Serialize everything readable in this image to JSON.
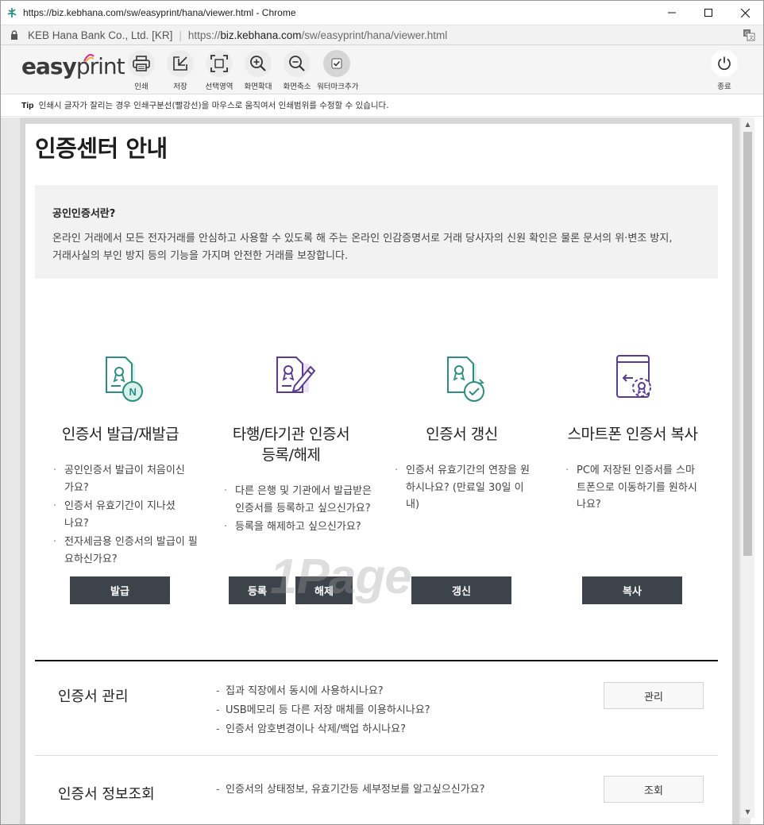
{
  "window": {
    "title": "https://biz.kebhana.com/sw/easyprint/hana/viewer.html - Chrome",
    "controls": {
      "minimize": "–",
      "maximize": "☐",
      "close": "✕"
    }
  },
  "address_bar": {
    "org": "KEB Hana Bank Co., Ltd. [KR]",
    "separator": "|",
    "url_scheme": "https://",
    "url_host": "biz.kebhana.com",
    "url_path": "/sw/easyprint/hana/viewer.html"
  },
  "toolbar": {
    "logo_easy": "easy",
    "logo_print": "print",
    "buttons": [
      {
        "label": "인쇄",
        "icon": "printer-icon"
      },
      {
        "label": "저장",
        "icon": "save-icon"
      },
      {
        "label": "선택영역",
        "icon": "select-area-icon"
      },
      {
        "label": "화면확대",
        "icon": "zoom-in-icon"
      },
      {
        "label": "화면축소",
        "icon": "zoom-out-icon"
      },
      {
        "label": "워터마크추가",
        "icon": "checkbox-icon"
      }
    ],
    "exit_label": "종료"
  },
  "tip": {
    "prefix": "Tip",
    "text": "인쇄시 글자가 잘리는 경우 인쇄구분선(빨강선)을 마우스로 움직여서 인쇄범위를 수정할 수 있습니다."
  },
  "page": {
    "title": "인증센터 안내",
    "info": {
      "heading": "공인인증서란?",
      "body_line1": "온라인 거래에서 모든 전자거래를 안심하고 사용할 수 있도록 해 주는 온라인 인감증명서로 거래 당사자의 신원 확인은 물론 문서의 위·변조 방지,",
      "body_line2": "거래사실의 부인 방지 등의 기능을 가지며 안전한 거래를 보장합니다."
    },
    "features": [
      {
        "title": "인증서 발급/재발급",
        "title2": "",
        "items": [
          "공인인증서 발급이 처음이신가요?",
          "인증서 유효기간이 지나셨나요?",
          "전자세금용 인증서의 발급이 필요하신가요?"
        ],
        "buttons": [
          "발급"
        ]
      },
      {
        "title": "타행/타기관 인증서",
        "title2": "등록/해제",
        "items": [
          "다른 은행 및 기관에서 발급받은 인증서를 등록하고 싶으신가요?",
          "등록을 해제하고 싶으신가요?"
        ],
        "buttons": [
          "등록",
          "해제"
        ]
      },
      {
        "title": "인증서 갱신",
        "title2": "",
        "items": [
          "인증서 유효기간의 연장을 원하시나요? (만료일 30일 이내)"
        ],
        "buttons": [
          "갱신"
        ]
      },
      {
        "title": "스마트폰 인증서 복사",
        "title2": "",
        "items": [
          "PC에 저장된 인증서를 스마트폰으로 이동하기를 원하시나요?"
        ],
        "buttons": [
          "복사"
        ]
      }
    ],
    "watermark": "1Page",
    "management": [
      {
        "title": "인증서 관리",
        "items": [
          "집과 직장에서 동시에 사용하시나요?",
          "USB메모리 등 다른 저장 매체를 이용하시나요?",
          "인증서 암호변경이나 삭제/백업 하시나요?"
        ],
        "button": "관리"
      },
      {
        "title": "인증서 정보조회",
        "items": [
          "인증서의 상태정보, 유효기간등 세부정보를 알고싶으신가요?"
        ],
        "button": "조회"
      }
    ]
  },
  "colors": {
    "teal": "#2a9a8a",
    "purple": "#6c4aa6",
    "button_dark": "#3d434a"
  }
}
